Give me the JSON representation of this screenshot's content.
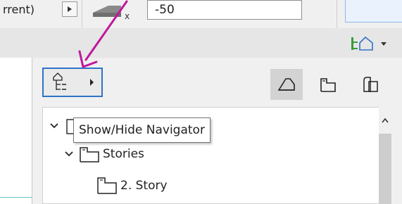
{
  "topbar": {
    "label": "rrent)",
    "input_value": "-50"
  },
  "navigator": {
    "tooltip": "Show/Hide Navigator",
    "tree": [
      {
        "label": "Stories",
        "icon": "story-icon",
        "expanded": true
      },
      {
        "label": "2. Story",
        "icon": "story-icon"
      }
    ],
    "view_modes": [
      "project-map-icon",
      "view-map-icon",
      "layout-book-icon"
    ],
    "selected_view_mode": "project-map-icon"
  },
  "annotation": {
    "arrow_color": "#c0179f"
  },
  "colors": {
    "accent": "#2e73c8",
    "arrow": "#c0179f"
  }
}
